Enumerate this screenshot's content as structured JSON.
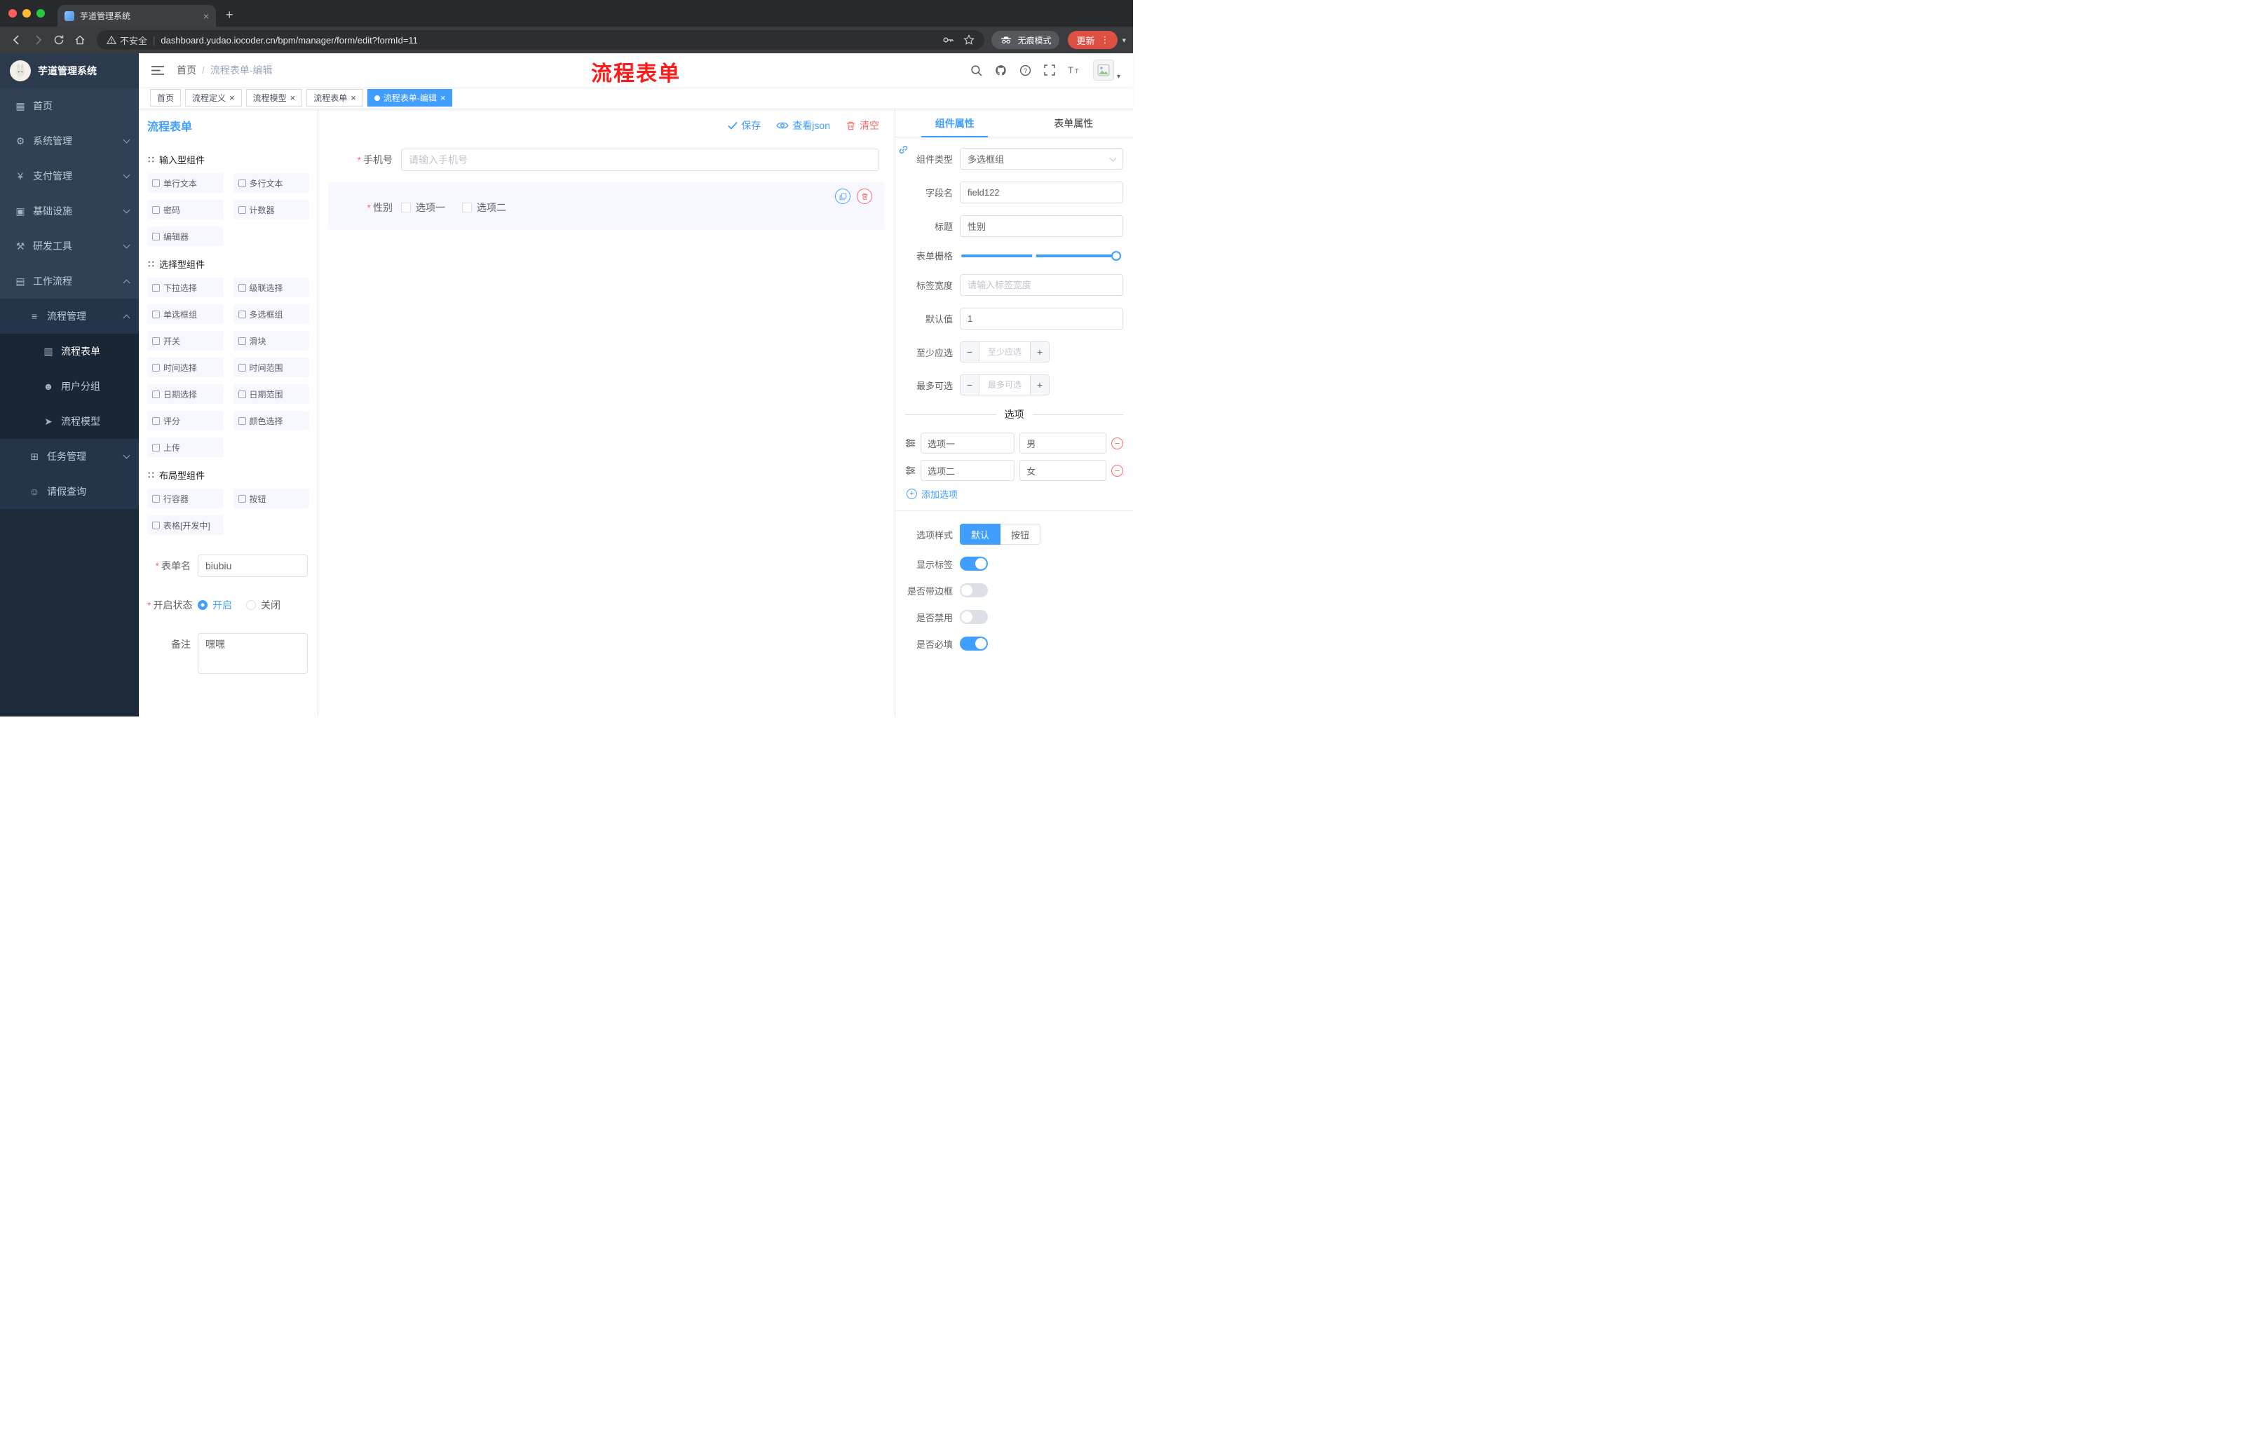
{
  "icons": {
    "close": "×",
    "add_tab": "+",
    "more": "⋮",
    "minus": "−",
    "plus": "+",
    "caret_down": "▾",
    "slash": "/",
    "pipe": "|"
  },
  "browser": {
    "tab_title": "芋道管理系统",
    "security_label": "不安全",
    "url": "dashboard.yudao.iocoder.cn/bpm/manager/form/edit?formId=11",
    "incognito_label": "无痕模式",
    "update_label": "更新"
  },
  "sidebar": {
    "logo_title": "芋道管理系统",
    "items": [
      {
        "icon": "▦",
        "label": "首页"
      },
      {
        "icon": "⚙",
        "label": "系统管理"
      },
      {
        "icon": "¥",
        "label": "支付管理"
      },
      {
        "icon": "▣",
        "label": "基础设施"
      },
      {
        "icon": "⚒",
        "label": "研发工具"
      },
      {
        "icon": "▤",
        "label": "工作流程"
      },
      {
        "icon": "≡",
        "label": "流程管理"
      },
      {
        "icon": "▥",
        "label": "流程表单"
      },
      {
        "icon": "☻",
        "label": "用户分组"
      },
      {
        "icon": "➤",
        "label": "流程模型"
      },
      {
        "icon": "⊞",
        "label": "任务管理"
      },
      {
        "icon": "☺",
        "label": "请假查询"
      }
    ]
  },
  "header": {
    "breadcrumb": {
      "home": "首页",
      "separator": "/",
      "current": "流程表单-编辑"
    },
    "annotation": "流程表单"
  },
  "tags": [
    {
      "label": "首页"
    },
    {
      "label": "流程定义"
    },
    {
      "label": "流程模型"
    },
    {
      "label": "流程表单"
    },
    {
      "label": "流程表单-编辑"
    }
  ],
  "editor": {
    "title": "流程表单",
    "actions": {
      "save": "保存",
      "view_json": "查看json",
      "clear": "清空"
    },
    "palette": {
      "groups": [
        {
          "title": "输入型组件",
          "items": [
            "单行文本",
            "多行文本",
            "密码",
            "计数器",
            "编辑器"
          ]
        },
        {
          "title": "选择型组件",
          "items": [
            "下拉选择",
            "级联选择",
            "单选框组",
            "多选框组",
            "开关",
            "滑块",
            "时间选择",
            "时间范围",
            "日期选择",
            "日期范围",
            "评分",
            "颜色选择",
            "上传"
          ]
        },
        {
          "title": "布局型组件",
          "items": [
            "行容器",
            "按钮",
            "表格[开发中]"
          ]
        }
      ],
      "form": {
        "name_label": "表单名",
        "name_value": "biubiu",
        "status_label": "开启状态",
        "status_on": "开启",
        "status_off": "关闭",
        "remark_label": "备注",
        "remark_value": "嘿嘿"
      }
    },
    "canvas": {
      "phone": {
        "label": "手机号",
        "placeholder": "请输入手机号"
      },
      "gender": {
        "label": "性别",
        "option1": "选项一",
        "option2": "选项二"
      }
    },
    "props": {
      "tab_component": "组件属性",
      "tab_form": "表单属性",
      "component_type_label": "组件类型",
      "component_type_value": "多选框组",
      "field_name_label": "字段名",
      "field_name_value": "field122",
      "title_label": "标题",
      "title_value": "性别",
      "grid_label": "表单栅格",
      "label_width_label": "标签宽度",
      "label_width_placeholder": "请输入标签宽度",
      "default_label": "默认值",
      "default_value": "1",
      "min_label": "至少应选",
      "min_placeholder": "至少应选",
      "max_label": "最多可选",
      "max_placeholder": "最多可选",
      "options_title": "选项",
      "options": [
        {
          "name": "选项一",
          "value": "男"
        },
        {
          "name": "选项二",
          "value": "女"
        }
      ],
      "add_option": "添加选项",
      "style_label": "选项样式",
      "style_default": "默认",
      "style_button": "按钮",
      "show_label": "显示标签",
      "bordered_label": "是否带边框",
      "disabled_label": "是否禁用",
      "required_label": "是否必填"
    }
  }
}
